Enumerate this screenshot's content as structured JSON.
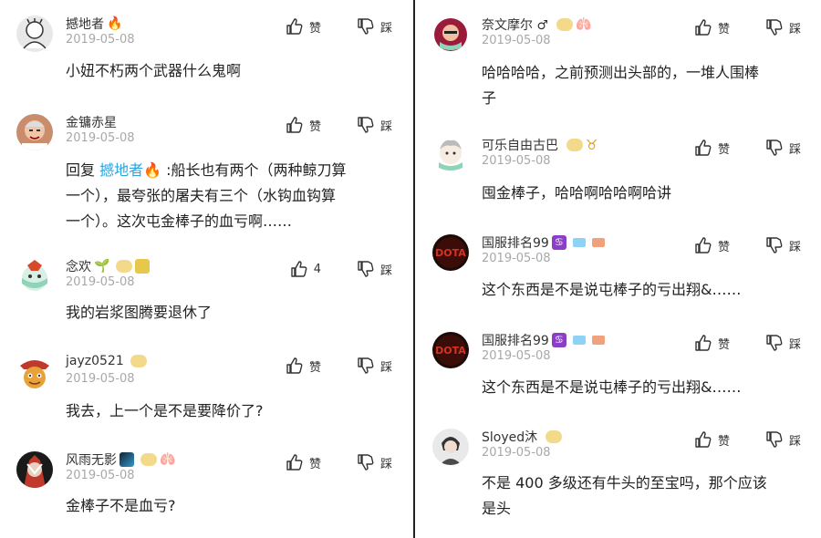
{
  "left_comments": [
    {
      "name": "撼地者",
      "time": "2019-05-08",
      "text": "小妞不朽两个武器什么鬼啊",
      "like": "赞",
      "dislike": "踩"
    },
    {
      "name": "金镛赤星",
      "time": "2019-05-08",
      "reply_prefix": "回复 ",
      "mention": "撼地者🔥",
      "text_line1": " :船长也有两个（两种鲸刀算",
      "text_line2": "一个），最夸张的屠夫有三个（水钩血钩算",
      "text_line3": "一个）。这次屯金棒子的血亏啊……",
      "like": "赞",
      "dislike": "踩"
    },
    {
      "name": "念欢",
      "time": "2019-05-08",
      "text": "我的岩浆图腾要退休了",
      "like": "4",
      "dislike": "踩"
    },
    {
      "name": "jayz0521",
      "time": "2019-05-08",
      "text": "我去，上一个是不是要降价了?",
      "like": "赞",
      "dislike": "踩"
    },
    {
      "name": "风雨无影",
      "time": "2019-05-08",
      "text": "金棒子不是血亏?",
      "like": "赞",
      "dislike": "踩"
    }
  ],
  "right_comments": [
    {
      "name": "奈文摩尔 ♂",
      "time": "2019-05-08",
      "text_line1": "哈哈哈哈，之前预测出头部的，一堆人围棒",
      "text_line2": "子",
      "like": "赞",
      "dislike": "踩"
    },
    {
      "name": "可乐自由古巴",
      "time": "2019-05-08",
      "text": "囤金棒子，哈哈啊哈哈啊哈讲",
      "like": "赞",
      "dislike": "踩"
    },
    {
      "name": "国服排名99",
      "time": "2019-05-08",
      "text": "这个东西是不是说屯棒子的亏出翔&……",
      "like": "赞",
      "dislike": "踩"
    },
    {
      "name": "国服排名99",
      "time": "2019-05-08",
      "text": "这个东西是不是说屯棒子的亏出翔&……",
      "like": "赞",
      "dislike": "踩"
    },
    {
      "name": "Sloyed沐",
      "time": "2019-05-08",
      "text_line1": "不是 400 多级还有牛头的至宝吗，那个应该",
      "text_line2": "是头",
      "like": "赞",
      "dislike": "踩"
    }
  ],
  "emojis": {
    "fire": "🔥",
    "sprout": "🌱",
    "lungs": "🫁"
  },
  "colors": {
    "mention": "#2aa4e0",
    "time": "#a8a8a8",
    "badge_gold": "#f3d98a",
    "badge_blue": "#8fd3f4",
    "badge_red": "#f0a27d",
    "badge_purple": "#8b3fc7"
  }
}
